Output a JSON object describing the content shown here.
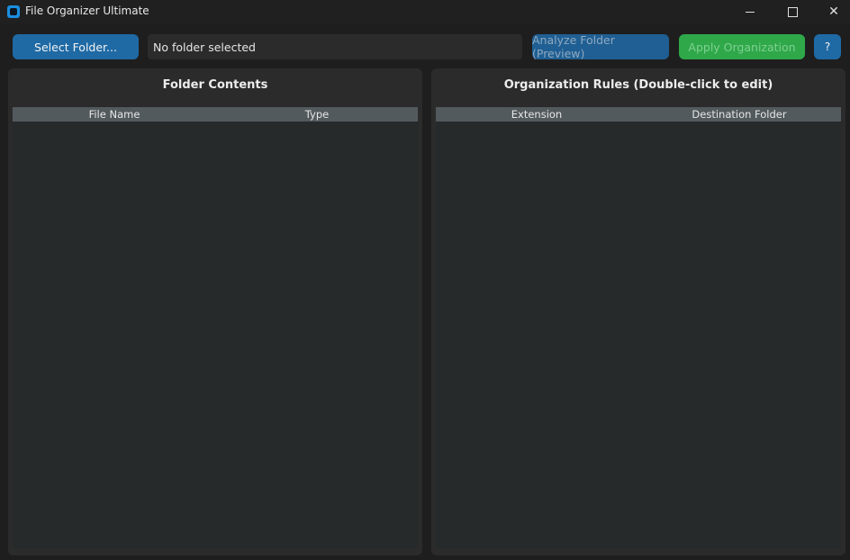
{
  "window": {
    "title": "File Organizer Ultimate",
    "icon": "app-icon",
    "controls": {
      "minimize": "minimize-icon",
      "maximize": "maximize-icon",
      "close": "✕"
    }
  },
  "toolbar": {
    "select_folder_label": "Select Folder...",
    "folder_path_value": "No folder selected",
    "analyze_label": "Analyze Folder (Preview)",
    "apply_label": "Apply Organization",
    "help_label": "?"
  },
  "colors": {
    "accent_blue": "#1f6aa5",
    "apply_green": "#2fa84a",
    "panel_bg": "#2b2b2b",
    "header_bg": "#535a5e"
  },
  "folder_panel": {
    "title": "Folder Contents",
    "columns": [
      "File Name",
      "Type"
    ],
    "rows": []
  },
  "rules_panel": {
    "title": "Organization Rules (Double-click to edit)",
    "columns": [
      "Extension",
      "Destination Folder"
    ],
    "rows": []
  }
}
